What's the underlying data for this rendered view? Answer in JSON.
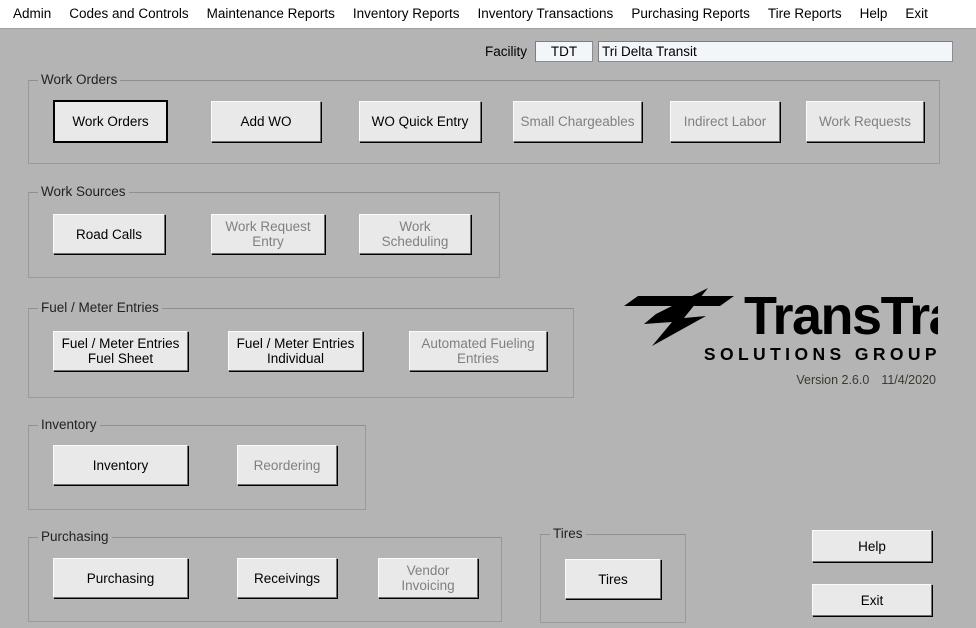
{
  "menubar": {
    "items": [
      {
        "label": "Admin",
        "name": "menu-admin"
      },
      {
        "label": "Codes and Controls",
        "name": "menu-codes-and-controls"
      },
      {
        "label": "Maintenance Reports",
        "name": "menu-maintenance-reports"
      },
      {
        "label": "Inventory Reports",
        "name": "menu-inventory-reports"
      },
      {
        "label": "Inventory Transactions",
        "name": "menu-inventory-transactions"
      },
      {
        "label": "Purchasing Reports",
        "name": "menu-purchasing-reports"
      },
      {
        "label": "Tire Reports",
        "name": "menu-tire-reports"
      },
      {
        "label": "Help",
        "name": "menu-help"
      },
      {
        "label": "Exit",
        "name": "menu-exit"
      }
    ]
  },
  "facility": {
    "label": "Facility",
    "code": "TDT",
    "code_placeholder": "",
    "name": "Tri Delta Transit",
    "name_placeholder": ""
  },
  "groups": {
    "work_orders": {
      "title": "Work Orders",
      "buttons": [
        {
          "label": "Work Orders",
          "state": "default"
        },
        {
          "label": "Add WO",
          "state": "enabled"
        },
        {
          "label": "WO Quick Entry",
          "state": "enabled"
        },
        {
          "label": "Small Chargeables",
          "state": "disabled"
        },
        {
          "label": "Indirect Labor",
          "state": "disabled"
        },
        {
          "label": "Work Requests",
          "state": "disabled"
        }
      ]
    },
    "work_sources": {
      "title": "Work Sources",
      "buttons": [
        {
          "label": "Road Calls",
          "state": "enabled"
        },
        {
          "label": "Work Request\nEntry",
          "state": "disabled"
        },
        {
          "label": "Work\nScheduling",
          "state": "disabled"
        }
      ]
    },
    "fuel_meter": {
      "title": "Fuel / Meter Entries",
      "buttons": [
        {
          "label": "Fuel / Meter Entries\nFuel Sheet",
          "state": "enabled"
        },
        {
          "label": "Fuel / Meter Entries\nIndividual",
          "state": "enabled"
        },
        {
          "label": "Automated Fueling\nEntries",
          "state": "disabled"
        }
      ]
    },
    "inventory": {
      "title": "Inventory",
      "buttons": [
        {
          "label": "Inventory",
          "state": "enabled"
        },
        {
          "label": "Reordering",
          "state": "disabled"
        }
      ]
    },
    "purchasing": {
      "title": "Purchasing",
      "buttons": [
        {
          "label": "Purchasing",
          "state": "enabled"
        },
        {
          "label": "Receivings",
          "state": "enabled"
        },
        {
          "label": "Vendor\nInvoicing",
          "state": "disabled"
        }
      ]
    },
    "tires": {
      "title": "Tires",
      "buttons": [
        {
          "label": "Tires",
          "state": "enabled"
        }
      ]
    }
  },
  "actions": {
    "help_label": "Help",
    "exit_label": "Exit"
  },
  "branding": {
    "wordmark": "TransTrack",
    "tagline": "SOLUTIONS GROUP",
    "version": "Version 2.6.0",
    "date": "11/4/2020"
  },
  "colors": {
    "background": "#b4b4b4",
    "menubar": "#ffffff",
    "button_face": "#e9e9e9",
    "disabled_text": "#808080",
    "field_background": "#f2f5fa",
    "group_border": "#9a9a9a"
  }
}
